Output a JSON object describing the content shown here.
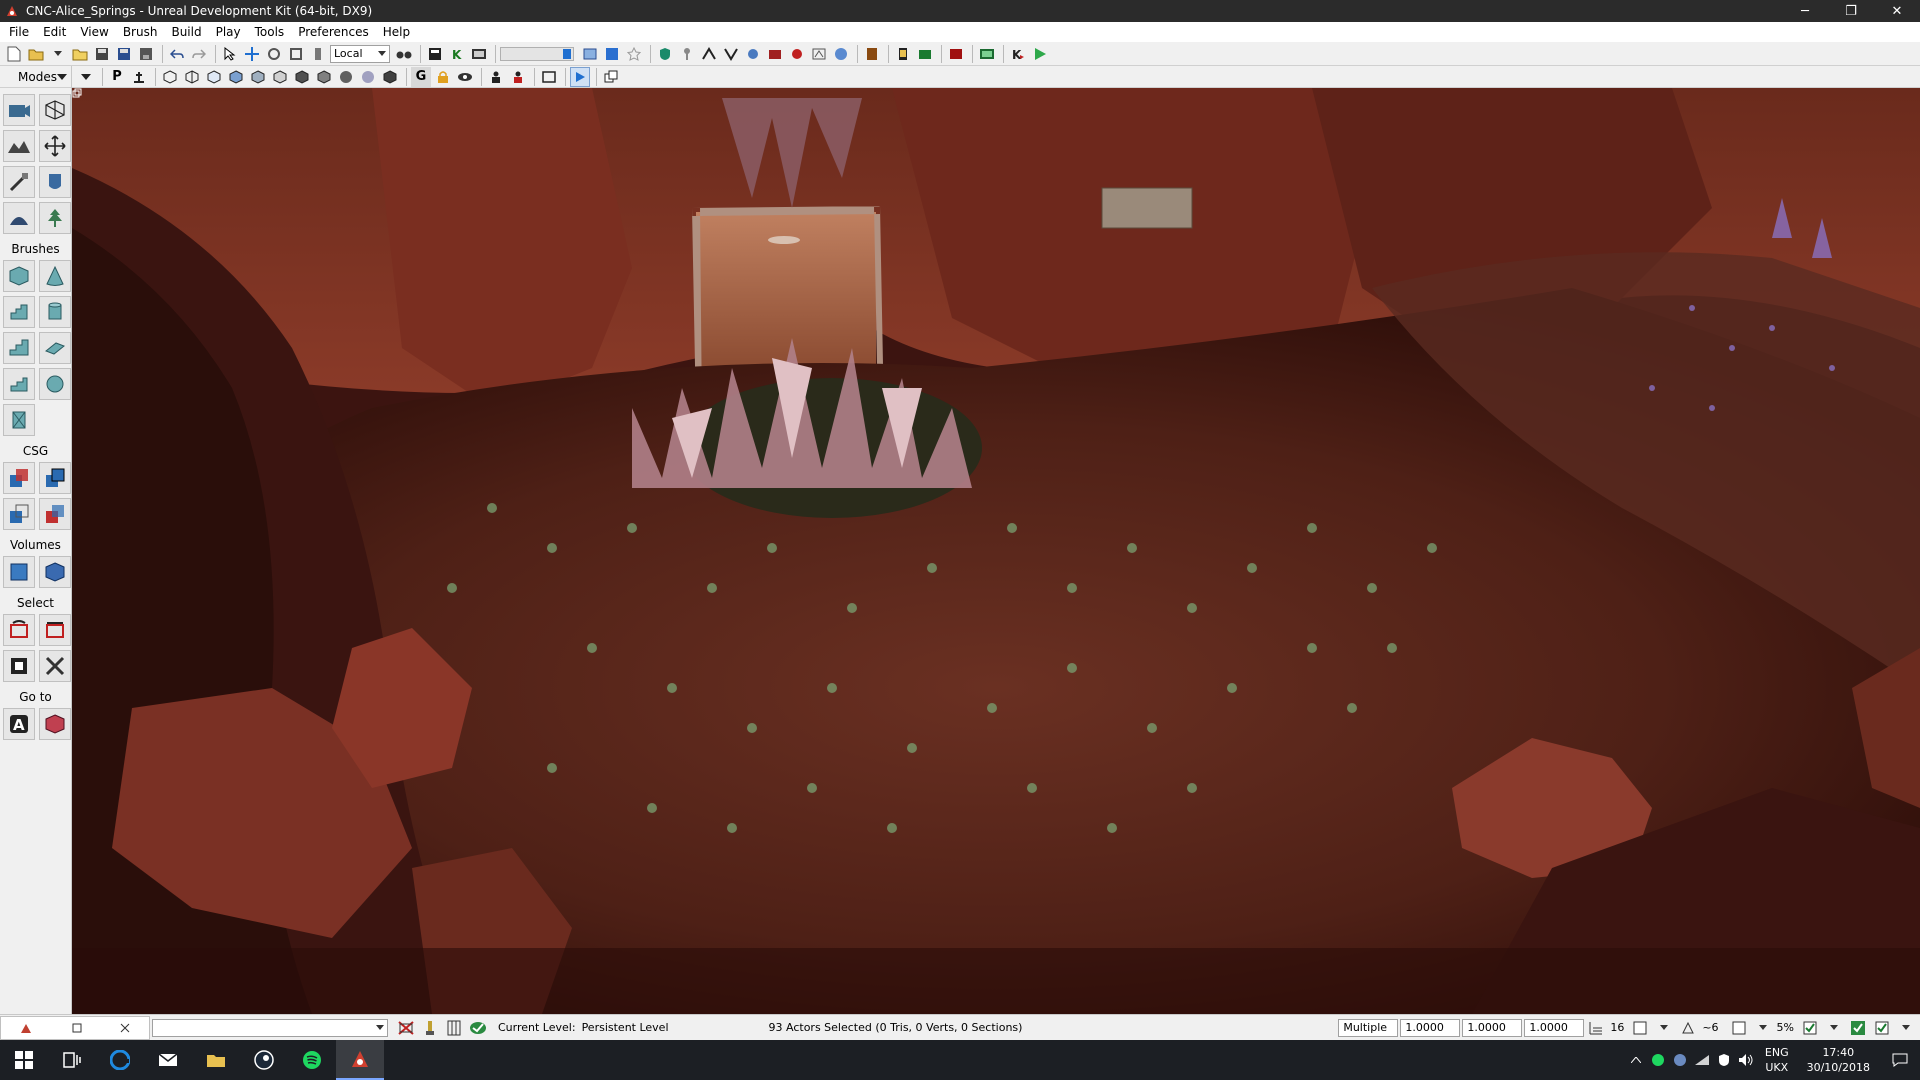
{
  "window": {
    "title": "CNC-Alice_Springs - Unreal Development Kit (64-bit, DX9)",
    "minimize": "─",
    "restore": "❐",
    "close": "✕"
  },
  "menu": [
    "File",
    "Edit",
    "View",
    "Brush",
    "Build",
    "Play",
    "Tools",
    "Preferences",
    "Help"
  ],
  "toolbar": {
    "coord_system": "Local",
    "letter_p": "P",
    "letter_g": "G"
  },
  "modes_panel": {
    "header": "Modes",
    "sections": {
      "brushes": "Brushes",
      "csg": "CSG",
      "volumes": "Volumes",
      "select": "Select",
      "goto": "Go to"
    }
  },
  "status": {
    "current_level_label": "Current Level:",
    "current_level_value": "Persistent Level",
    "selection_info": "93 Actors Selected (0 Tris, 0 Verts, 0 Sections)",
    "scale_mode": "Multiple",
    "scale_x": "1.0000",
    "scale_y": "1.0000",
    "scale_z": "1.0000",
    "grid_size": "16",
    "rotation_snap": "~6",
    "scale_snap": "5%"
  },
  "taskbar": {
    "lang_top": "ENG",
    "lang_bottom": "UKX",
    "time": "17:40",
    "date": "30/10/2018"
  },
  "colors": {
    "accent_play": "#2ea84a",
    "accent_blue": "#1f6fd0",
    "terrain_red": "#7a2a1e"
  }
}
